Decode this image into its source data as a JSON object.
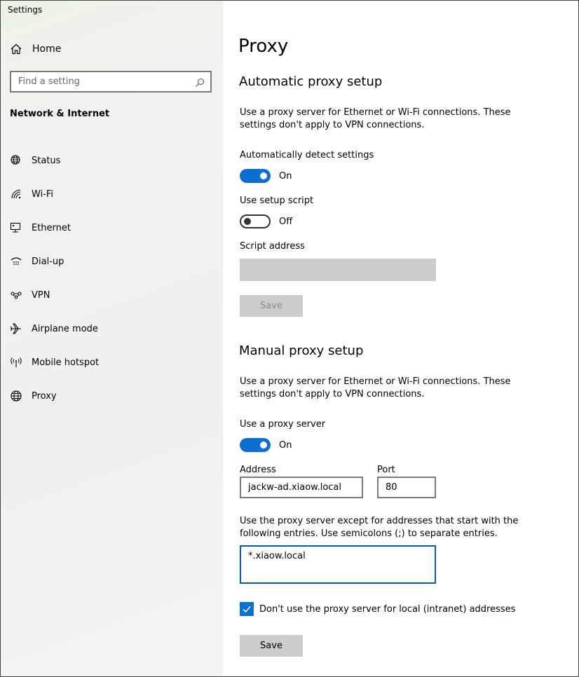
{
  "window": {
    "title": "Settings"
  },
  "sidebar": {
    "home_label": "Home",
    "search_placeholder": "Find a setting",
    "section_title": "Network & Internet",
    "items": [
      {
        "label": "Status",
        "icon": "globe-status-icon"
      },
      {
        "label": "Wi-Fi",
        "icon": "wifi-icon"
      },
      {
        "label": "Ethernet",
        "icon": "ethernet-icon"
      },
      {
        "label": "Dial-up",
        "icon": "dialup-icon"
      },
      {
        "label": "VPN",
        "icon": "vpn-icon"
      },
      {
        "label": "Airplane mode",
        "icon": "airplane-icon"
      },
      {
        "label": "Mobile hotspot",
        "icon": "hotspot-icon"
      },
      {
        "label": "Proxy",
        "icon": "globe-icon"
      }
    ]
  },
  "main": {
    "page_title": "Proxy",
    "automatic": {
      "heading": "Automatic proxy setup",
      "description": "Use a proxy server for Ethernet or Wi-Fi connections. These settings don't apply to VPN connections.",
      "detect_label": "Automatically detect settings",
      "detect_state": "On",
      "script_label": "Use setup script",
      "script_state": "Off",
      "address_label": "Script address",
      "address_value": "",
      "save_label": "Save"
    },
    "manual": {
      "heading": "Manual proxy setup",
      "description": "Use a proxy server for Ethernet or Wi-Fi connections. These settings don't apply to VPN connections.",
      "use_label": "Use a proxy server",
      "use_state": "On",
      "address_label": "Address",
      "address_value": "jackw-ad.xiaow.local",
      "port_label": "Port",
      "port_value": "80",
      "exceptions_description": "Use the proxy server except for addresses that start with the following entries. Use semicolons (;) to separate entries.",
      "exceptions_value": "*.xiaow.local",
      "local_checkbox_label": "Don't use the proxy server for local (intranet) addresses",
      "local_checked": true,
      "save_label": "Save"
    }
  },
  "colors": {
    "accent": "#0a6fd0",
    "disabled": "#cccccc"
  }
}
